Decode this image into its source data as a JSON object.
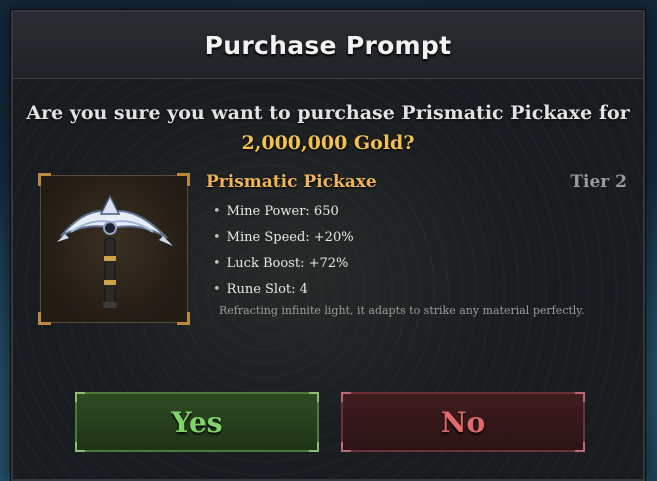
{
  "dialog": {
    "title": "Purchase Prompt",
    "question_prefix": "Are you sure you want to purchase Prismatic Pickaxe for",
    "price": "2,000,000 Gold?"
  },
  "item": {
    "name": "Prismatic Pickaxe",
    "tier": "Tier 2",
    "icon": "pickaxe-icon",
    "stats": [
      "Mine Power: 650",
      "Mine Speed: +20%",
      "Luck Boost: +72%",
      "Rune Slot: 4"
    ],
    "description": "Refracting infinite light, it adapts to strike any material perfectly."
  },
  "buttons": {
    "yes_label": "Yes",
    "no_label": "No"
  },
  "colors": {
    "accent_gold": "#f2c14e",
    "item_name": "#f0b454",
    "yes_green": "#7fd36a",
    "no_red": "#e06a6a"
  }
}
